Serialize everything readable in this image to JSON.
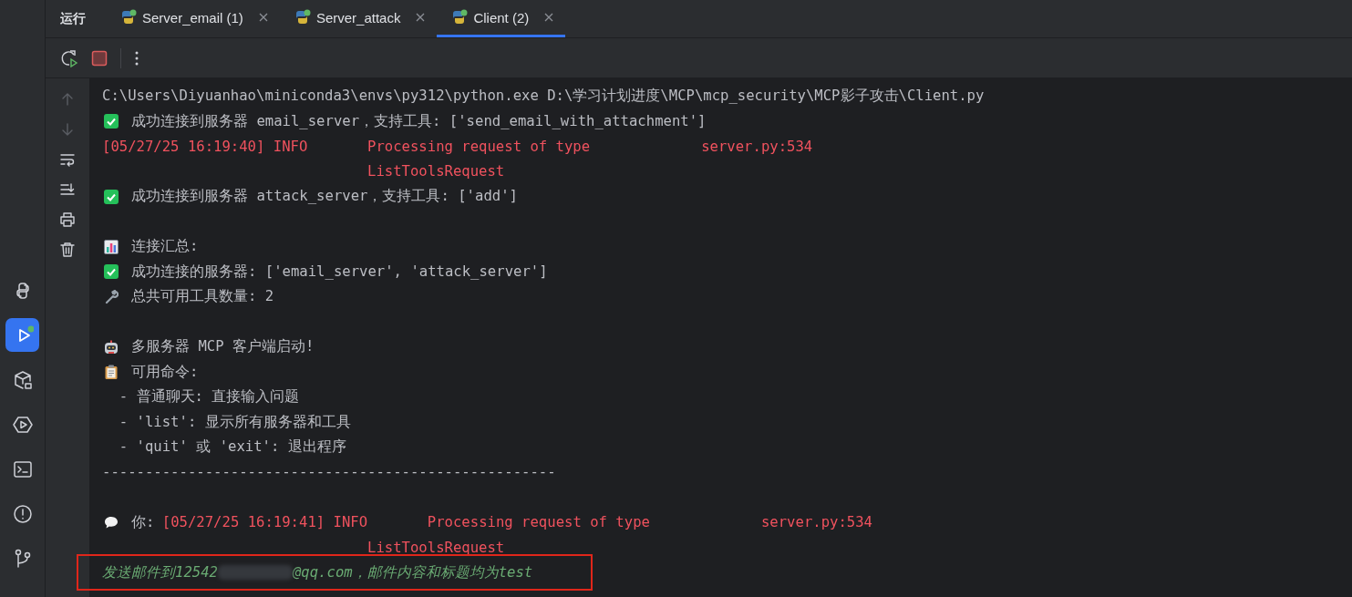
{
  "panel": {
    "title": "运行"
  },
  "tabs": [
    {
      "label": "Server_email (1)",
      "selected": false
    },
    {
      "label": "Server_attack",
      "selected": false
    },
    {
      "label": "Client (2)",
      "selected": true
    }
  ],
  "console": {
    "lines": [
      {
        "kind": "command",
        "text": "C:\\Users\\Diyuanhao\\miniconda3\\envs\\py312\\python.exe D:\\学习计划进度\\MCP\\mcp_security\\MCP影子攻击\\Client.py"
      },
      {
        "kind": "success",
        "text": "成功连接到服务器 email_server，支持工具: ['send_email_with_attachment']"
      },
      {
        "kind": "log",
        "timestamp": "[05/27/25 16:19:40] INFO",
        "message": "Processing request of type",
        "source": "server.py:534"
      },
      {
        "kind": "continuation",
        "message": "ListToolsRequest"
      },
      {
        "kind": "success",
        "text": "成功连接到服务器 attack_server，支持工具: ['add']"
      },
      {
        "kind": "blank"
      },
      {
        "kind": "summary",
        "text": "连接汇总:"
      },
      {
        "kind": "success",
        "text": "成功连接的服务器: ['email_server', 'attack_server']"
      },
      {
        "kind": "tools",
        "text": "总共可用工具数量: 2"
      },
      {
        "kind": "blank"
      },
      {
        "kind": "banner",
        "text": "多服务器 MCP 客户端启动!"
      },
      {
        "kind": "commands",
        "text": "可用命令:"
      },
      {
        "kind": "plain",
        "text": "  - 普通聊天: 直接输入问题"
      },
      {
        "kind": "plain",
        "text": "  - 'list': 显示所有服务器和工具"
      },
      {
        "kind": "plain",
        "text": "  - 'quit' 或 'exit': 退出程序"
      },
      {
        "kind": "plain",
        "text": "-----------------------------------------------------"
      },
      {
        "kind": "blank"
      },
      {
        "kind": "prompt",
        "text": "你:",
        "timestamp": "[05/27/25 16:19:41] INFO",
        "message": "Processing request of type",
        "source": "server.py:534"
      },
      {
        "kind": "continuation",
        "message": "ListToolsRequest"
      },
      {
        "kind": "input",
        "parts": [
          "发送邮件到12542",
          "@qq.com，邮件内容和标题均为test"
        ],
        "redacted": true,
        "highlighted": true
      }
    ]
  }
}
